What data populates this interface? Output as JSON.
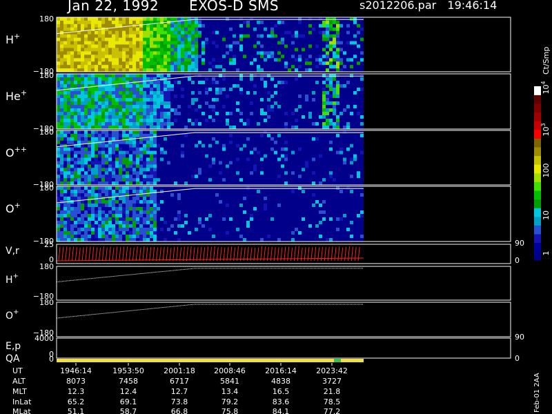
{
  "title": {
    "date": "Jan 22, 1992",
    "instrument": "EXOS-D SMS",
    "file": "s2012206.par",
    "time": "19:46:14"
  },
  "chart_data": {
    "type": "heatmap",
    "panels": [
      {
        "id": "h-plus",
        "label": "H",
        "sup": "+",
        "ymax": "180",
        "ymin": "−180"
      },
      {
        "id": "he-plus",
        "label": "He",
        "sup": "+",
        "ymax": "180",
        "ymin": "−180"
      },
      {
        "id": "o-plus-plus",
        "label": "O",
        "sup": "++",
        "ymax": "180",
        "ymin": "−180"
      },
      {
        "id": "o-plus",
        "label": "O",
        "sup": "+",
        "ymax": "180",
        "ymin": "−180"
      }
    ],
    "line_panels": [
      {
        "id": "vr",
        "label": "V,r",
        "ymax": "25",
        "ymin": "0",
        "right_top": "90",
        "right_bottom": "0",
        "color": "#ff2020"
      },
      {
        "id": "h-plus-pitch",
        "label": "H",
        "sup": "+",
        "ymax": "180",
        "ymin": "−180"
      },
      {
        "id": "o-plus-pitch",
        "label": "O",
        "sup": "+",
        "ymax": "180",
        "ymin": "−180"
      },
      {
        "id": "ep",
        "label": "E,p",
        "ymax": "4000",
        "ymin": "0",
        "right_top": "90"
      },
      {
        "id": "qa",
        "label": "QA",
        "ymin": "0",
        "right_bottom": "0"
      }
    ],
    "colorbar": {
      "unit": "Ct/Smp",
      "ticks": [
        {
          "label": "1",
          "exp": ""
        },
        {
          "label": "10",
          "exp": ""
        },
        {
          "label": "100",
          "exp": ""
        },
        {
          "label": "10",
          "exp": "3"
        },
        {
          "label": "10",
          "exp": "4"
        }
      ],
      "colors": [
        "#00008b",
        "#00009c",
        "#1414b4",
        "#2850d0",
        "#00a0c8",
        "#00c8e0",
        "#00a000",
        "#00c000",
        "#40e000",
        "#a0e000",
        "#e8e800",
        "#c8c000",
        "#a08c00",
        "#806400",
        "#ff0000",
        "#c80000",
        "#a00000",
        "#800000",
        "#600000",
        "#ffffff"
      ]
    },
    "time_axis": {
      "UT": [
        "1946:14",
        "1953:50",
        "2001:18",
        "2008:46",
        "2016:14",
        "2023:42"
      ],
      "ALT": [
        "8073",
        "7458",
        "6717",
        "5841",
        "4838",
        "3727"
      ],
      "MLT": [
        "12.3",
        "12.4",
        "12.7",
        "13.4",
        "16.5",
        "21.8"
      ],
      "InLat": [
        "65.2",
        "69.1",
        "73.8",
        "79.2",
        "83.6",
        "78.5"
      ],
      "MLat": [
        "51.1",
        "58.7",
        "66.8",
        "75.8",
        "84.1",
        "77.2"
      ]
    },
    "row_labels": [
      "UT",
      "ALT",
      "MLT",
      "InLat",
      "MLat"
    ],
    "footer_note": "Feb-01 2AA"
  }
}
